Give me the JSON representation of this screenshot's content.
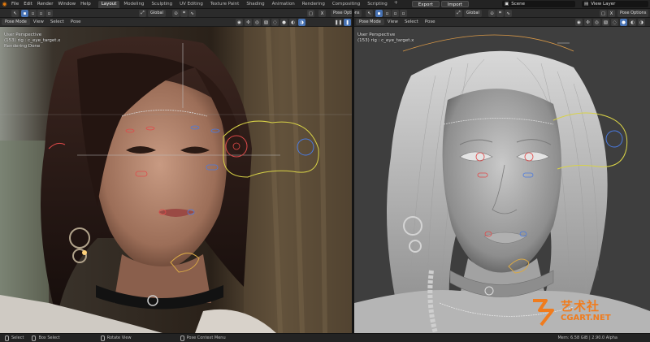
{
  "app": {
    "logo_icon": "blender-logo-icon",
    "menus": [
      "File",
      "Edit",
      "Render",
      "Window",
      "Help"
    ],
    "workspace_tabs": [
      "Layout",
      "Modeling",
      "Sculpting",
      "UV Editing",
      "Texture Paint",
      "Shading",
      "Animation",
      "Rendering",
      "Compositing",
      "Scripting"
    ],
    "active_tab": "Layout",
    "add_tab": "+",
    "export_label": "Export",
    "import_label": "Import",
    "scene_name": "Scene",
    "view_layer_name": "View Layer"
  },
  "toolbar": {
    "orientation_left": "Global",
    "orientation_right": "Global",
    "pose_options": "Pose Options"
  },
  "left_view": {
    "mode": "Pose Mode",
    "menus": [
      "View",
      "Select",
      "Pose"
    ],
    "perspective": "User Perspective",
    "object_info": "(153) rig : c_eye_target.x",
    "status": "Rendering Done"
  },
  "right_view": {
    "mode": "Pose Mode",
    "menus": [
      "View",
      "Select",
      "Pose"
    ],
    "perspective": "User Perspective",
    "object_info": "(153) rig : c_eye_target.x"
  },
  "statusbar": {
    "select": "Select",
    "box_select": "Box Select",
    "rotate_view": "Rotate View",
    "context_menu": "Pose Context Menu",
    "stats": "Mem: 6.58 GiB | 2.90.0 Alpha"
  },
  "watermark": {
    "cn": "艺术社",
    "en": "CGART.NET"
  },
  "colors": {
    "accent": "#4772b3",
    "brand_orange": "#e87d0d",
    "watermark": "#f07c1e"
  }
}
